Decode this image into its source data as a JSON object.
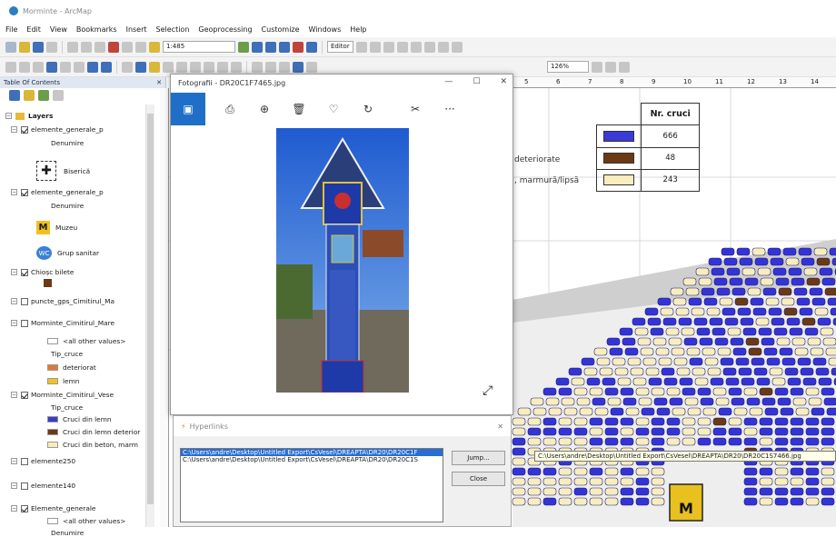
{
  "window": {
    "title": "Morminte - ArcMap"
  },
  "menu": [
    "File",
    "Edit",
    "View",
    "Bookmarks",
    "Insert",
    "Selection",
    "Geoprocessing",
    "Customize",
    "Windows",
    "Help"
  ],
  "toolbar": {
    "scale": "1:485",
    "editor": "Editor",
    "zoom": "126%"
  },
  "toc": {
    "title": "Table Of Contents",
    "layers_label": "Layers",
    "rows": [
      {
        "label": "elemente_generale_p",
        "checked": true,
        "kind": "layer"
      },
      {
        "label": "Denumire",
        "kind": "sub"
      },
      {
        "label": "Biserică",
        "kind": "symbol-cross"
      },
      {
        "label": "elemente_generale_p",
        "checked": true,
        "kind": "layer"
      },
      {
        "label": "Denumire",
        "kind": "sub"
      },
      {
        "label": "Muzeu",
        "kind": "symbol-m"
      },
      {
        "label": "Grup sanitar",
        "kind": "symbol-wc"
      },
      {
        "label": "Chioșc bilete",
        "checked": true,
        "kind": "layer"
      },
      {
        "label": "puncte_gps_Cimitirul_Ma",
        "checked": false,
        "kind": "layer"
      },
      {
        "label": "Morminte_Cimitirul_Mare",
        "checked": false,
        "kind": "layer"
      },
      {
        "label": "<all other values>",
        "kind": "swatch",
        "color": "#ffffff"
      },
      {
        "label": "Tip_cruce",
        "kind": "sub"
      },
      {
        "label": "deteriorat",
        "kind": "swatch",
        "color": "#e07a30"
      },
      {
        "label": "lemn",
        "kind": "swatch",
        "color": "#f0c420"
      },
      {
        "label": "Morminte_Cimitirul_Vese",
        "checked": true,
        "kind": "layer"
      },
      {
        "label": "Tip_cruce",
        "kind": "sub"
      },
      {
        "label": "Cruci din lemn",
        "kind": "swatch",
        "color": "#3a3acc"
      },
      {
        "label": "Cruci din lemn deterior",
        "kind": "swatch",
        "color": "#6b3a1a"
      },
      {
        "label": "Cruci din beton, marm",
        "kind": "swatch",
        "color": "#f7ecb8"
      },
      {
        "label": "elemente250",
        "checked": false,
        "kind": "layer"
      },
      {
        "label": "elemente140",
        "checked": false,
        "kind": "layer"
      },
      {
        "label": "Elemente_generale",
        "checked": true,
        "kind": "layer"
      },
      {
        "label": "<all other values>",
        "kind": "swatch",
        "color": "#ffffff"
      },
      {
        "label": "Denumire",
        "kind": "sub"
      }
    ]
  },
  "photos": {
    "title": "Fotografii - DR20C1F7465.jpg",
    "controls": [
      "—",
      "☐",
      "✕"
    ]
  },
  "legend": {
    "header": "Nr. cruci",
    "rows": [
      {
        "label": "",
        "color": "#3a3ad8",
        "value": "666"
      },
      {
        "label": "deteriorate",
        "color": "#6b3a14",
        "value": "48"
      },
      {
        "label": ", marmură/lipsă",
        "color": "#f8edbe",
        "value": "243"
      }
    ]
  },
  "hyperlinks": {
    "title": "Hyperlinks",
    "items": [
      "C:\\Users\\andre\\Desktop\\Untitled Export\\CsVesel\\DREAPTA\\DR20\\DR20C1F",
      "C:\\Users\\andre\\Desktop\\Untitled Export\\CsVesel\\DREAPTA\\DR20\\DR20C1S"
    ],
    "jump_label": "Jump...",
    "close_label": "Close"
  },
  "path_tooltip": "C:\\Users\\andre\\Desktop\\Untitled Export\\CsVesel\\DREAPTA\\DR20\\DR20C1S7466.jpg",
  "map_marker": "M",
  "ruler_ticks": [
    "5",
    "6",
    "7",
    "8",
    "9",
    "10",
    "11",
    "12",
    "13",
    "14"
  ],
  "colors": {
    "blue_cross": "#3434d6",
    "cream": "#f8edbe",
    "brown": "#6b3a14",
    "gray_zone": "#cfcfcf"
  }
}
